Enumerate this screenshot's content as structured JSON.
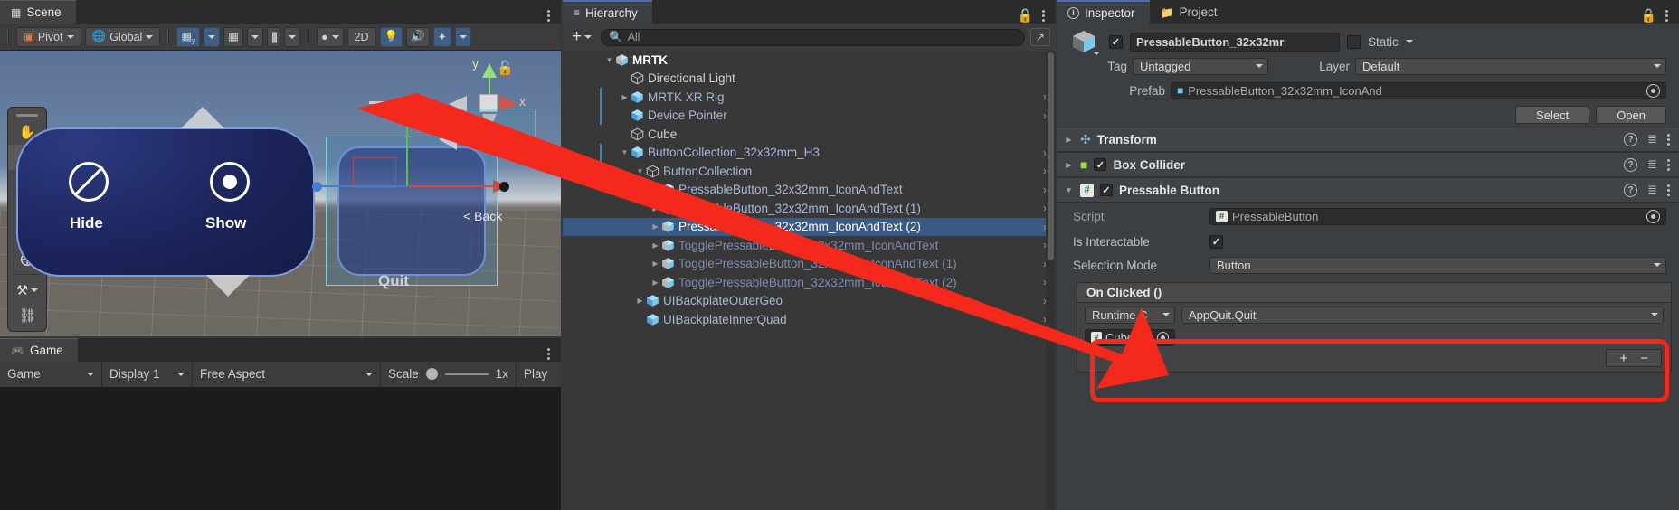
{
  "scene_panel": {
    "tab": {
      "label": "Scene",
      "icon": "grid-icon"
    },
    "toolbar": {
      "pivot": "Pivot",
      "global": "Global",
      "grid_icon": "grid-snap-y-icon",
      "snap_icon": "grid-snapping-icon",
      "ruler_icon": "ruler-icon",
      "shading_icon": "shading-sphere-icon",
      "twod": "2D",
      "light_icon": "light-bulb-icon",
      "audio_icon": "audio-mute-icon",
      "fx_icon": "effects-icon"
    },
    "tools": [
      {
        "name": "hand-tool",
        "glyph": "✋"
      },
      {
        "name": "move-tool",
        "glyph": "✥"
      },
      {
        "name": "rotate-tool",
        "glyph": "↻"
      },
      {
        "name": "scale-tool",
        "glyph": "⤡"
      },
      {
        "name": "rect-tool",
        "glyph": "⬚"
      },
      {
        "name": "transform-tool",
        "glyph": "⨁"
      },
      {
        "name": "custom-tool",
        "glyph": "⚒"
      },
      {
        "name": "joint-tool",
        "glyph": "⛓"
      }
    ],
    "viewport": {
      "slate_buttons": [
        "Hide",
        "Show"
      ],
      "quit_label": "Quit",
      "back_label": "< Back",
      "gizmo_axes": [
        "y",
        "x"
      ]
    }
  },
  "game_panel": {
    "tab": {
      "label": "Game",
      "icon": "gamepad-icon"
    },
    "controls": {
      "view": "Game",
      "display": "Display 1",
      "aspect": "Free Aspect",
      "scale_label": "Scale",
      "scale_value": "1x",
      "play_label": "Play"
    }
  },
  "hierarchy_panel": {
    "tab": {
      "label": "Hierarchy",
      "icon": "list-icon"
    },
    "toolbar": {
      "add_label": "+",
      "search_placeholder": "All",
      "search_value": ""
    },
    "items": [
      {
        "label": "MRTK",
        "depth": 0,
        "twisty": "down",
        "style": "root",
        "icon": "unity-gameobject-icon",
        "chevron": false,
        "prefab_bar": false
      },
      {
        "label": "Directional Light",
        "depth": 1,
        "twisty": "none",
        "style": "white",
        "icon": "gameobject-icon",
        "chevron": false,
        "prefab_bar": false
      },
      {
        "label": "MRTK XR Rig",
        "depth": 1,
        "twisty": "right",
        "style": "prefab",
        "icon": "prefab-icon",
        "chevron": true,
        "prefab_bar": true
      },
      {
        "label": "Device Pointer",
        "depth": 1,
        "twisty": "none",
        "style": "prefab",
        "icon": "prefab-icon",
        "chevron": true,
        "prefab_bar": true
      },
      {
        "label": "Cube",
        "depth": 1,
        "twisty": "none",
        "style": "white",
        "icon": "gameobject-icon",
        "chevron": false,
        "prefab_bar": false
      },
      {
        "label": "ButtonCollection_32x32mm_H3",
        "depth": 1,
        "twisty": "down",
        "style": "prefab",
        "icon": "prefab-icon",
        "chevron": true,
        "prefab_bar": true
      },
      {
        "label": "ButtonCollection",
        "depth": 2,
        "twisty": "down",
        "style": "prefab",
        "icon": "gameobject-icon",
        "chevron": true,
        "prefab_bar": false
      },
      {
        "label": "PressableButton_32x32mm_IconAndText",
        "depth": 3,
        "twisty": "right",
        "style": "prefab",
        "icon": "prefab-variant-icon",
        "chevron": true,
        "prefab_bar": false
      },
      {
        "label": "PressableButton_32x32mm_IconAndText (1)",
        "depth": 3,
        "twisty": "right",
        "style": "prefab",
        "icon": "prefab-variant-icon",
        "chevron": true,
        "prefab_bar": false
      },
      {
        "label": "PressableButton_32x32mm_IconAndText (2)",
        "depth": 3,
        "twisty": "right",
        "style": "selected",
        "icon": "prefab-variant-icon",
        "chevron": true,
        "prefab_bar": false
      },
      {
        "label": "TogglePressableButton_32x32mm_IconAndText",
        "depth": 3,
        "twisty": "right",
        "style": "dim",
        "icon": "prefab-variant-icon",
        "chevron": true,
        "prefab_bar": false
      },
      {
        "label": "TogglePressableButton_32x32mm_IconAndText (1)",
        "depth": 3,
        "twisty": "right",
        "style": "dim",
        "icon": "prefab-variant-icon",
        "chevron": true,
        "prefab_bar": false
      },
      {
        "label": "TogglePressableButton_32x32mm_IconAndText (2)",
        "depth": 3,
        "twisty": "right",
        "style": "dim",
        "icon": "prefab-variant-icon",
        "chevron": true,
        "prefab_bar": false
      },
      {
        "label": "UIBackplateOuterGeo",
        "depth": 2,
        "twisty": "right",
        "style": "prefab",
        "icon": "prefab-icon",
        "chevron": true,
        "prefab_bar": false
      },
      {
        "label": "UIBackplateInnerQuad",
        "depth": 2,
        "twisty": "none",
        "style": "prefab",
        "icon": "prefab-icon",
        "chevron": true,
        "prefab_bar": false
      }
    ]
  },
  "inspector_panel": {
    "tabs": [
      {
        "label": "Inspector",
        "icon": "info-icon",
        "active": true
      },
      {
        "label": "Project",
        "icon": "folder-icon",
        "active": false
      }
    ],
    "header": {
      "enabled": true,
      "name_value": "PressableButton_32x32mr",
      "static_label": "Static",
      "static_checked": false,
      "tag_label": "Tag",
      "tag_value": "Untagged",
      "layer_label": "Layer",
      "layer_value": "Default"
    },
    "prefab": {
      "label": "Prefab",
      "value": "PressableButton_32x32mm_IconAnd",
      "select_label": "Select",
      "open_label": "Open"
    },
    "components": [
      {
        "name": "Transform",
        "icon": "transform-icon",
        "has_checkbox": false,
        "checked": false,
        "expanded": false
      },
      {
        "name": "Box Collider",
        "icon": "collider-icon",
        "has_checkbox": true,
        "checked": true,
        "expanded": false
      },
      {
        "name": "Pressable Button",
        "icon": "script-icon",
        "has_checkbox": true,
        "checked": true,
        "expanded": true
      }
    ],
    "pressable_button": {
      "script_label": "Script",
      "script_value": "PressableButton",
      "is_interactable_label": "Is Interactable",
      "is_interactable_checked": true,
      "selection_mode_label": "Selection Mode",
      "selection_mode_value": "Button",
      "on_clicked_label": "On Clicked ()",
      "event_rows": [
        {
          "mode": "Runtime C",
          "function": "AppQuit.Quit",
          "object": "Cube (/"
        }
      ],
      "add_label": "+",
      "remove_label": "−"
    }
  },
  "annotation": {
    "arrow_color": "#f5281c",
    "highlight_color": "#f5281c"
  }
}
